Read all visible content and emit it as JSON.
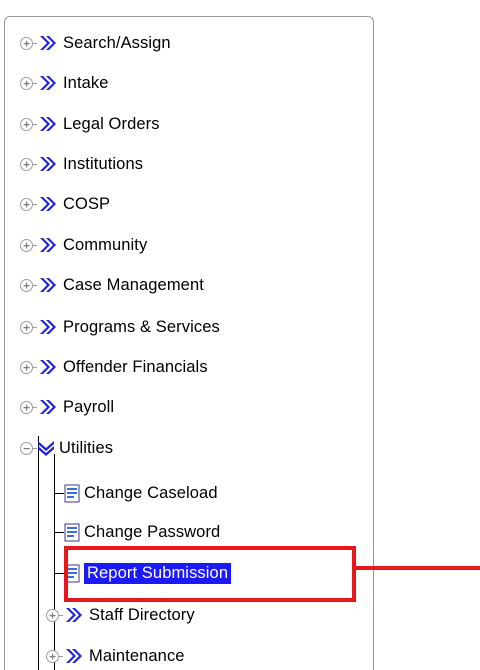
{
  "tree": {
    "top_level": [
      {
        "label": "Search/Assign"
      },
      {
        "label": "Intake"
      },
      {
        "label": "Legal Orders"
      },
      {
        "label": "Institutions"
      },
      {
        "label": "COSP"
      },
      {
        "label": "Community"
      },
      {
        "label": "Case Management"
      },
      {
        "label": "Programs & Services"
      },
      {
        "label": "Offender Financials"
      },
      {
        "label": "Payroll"
      },
      {
        "label": "Utilities",
        "expanded": true
      }
    ],
    "utilities_children": [
      {
        "label": "Change Caseload"
      },
      {
        "label": "Change Password"
      },
      {
        "label": "Report Submission",
        "selected": true
      },
      {
        "label": "Staff Directory"
      },
      {
        "label": "Maintenance"
      }
    ]
  },
  "colors": {
    "chevron": "#1f23d6",
    "selection": "#1a1afc",
    "highlight": "#e8181a"
  },
  "icons": {
    "collapsed_node": "plus-expander-icon",
    "expanded_node": "minus-expander-icon",
    "folder_marker": "double-chevron-icon",
    "leaf_marker": "document-icon"
  }
}
